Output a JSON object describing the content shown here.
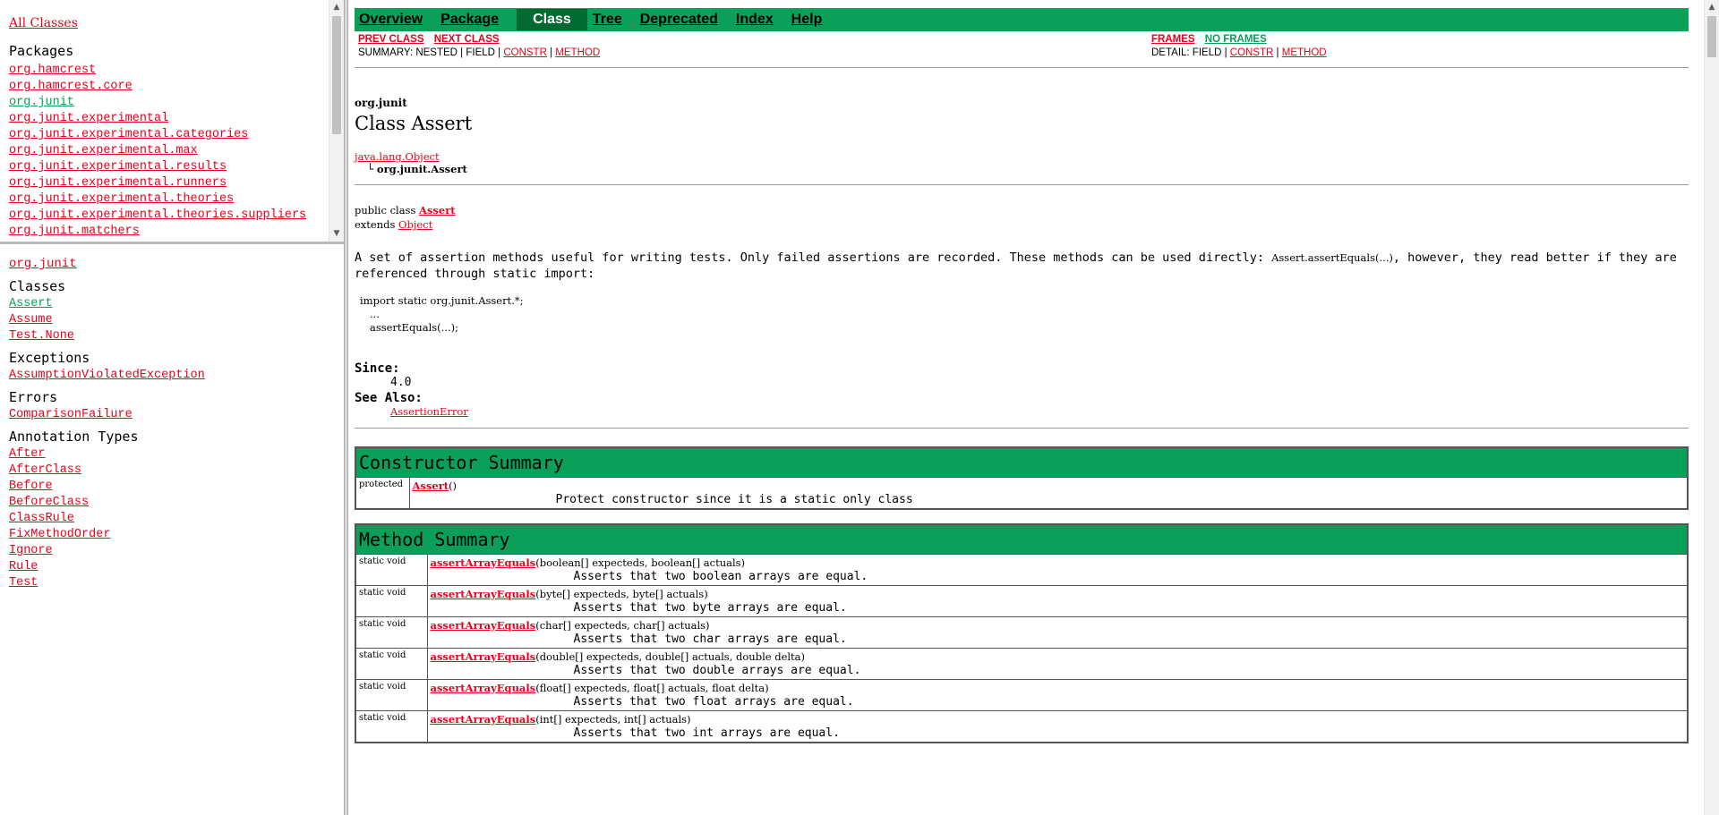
{
  "packages_frame": {
    "all_classes": "All Classes",
    "heading": "Packages",
    "items": [
      {
        "label": "org.hamcrest",
        "visited": false
      },
      {
        "label": "org.hamcrest.core",
        "visited": false
      },
      {
        "label": "org.junit",
        "visited": true
      },
      {
        "label": "org.junit.experimental",
        "visited": false
      },
      {
        "label": "org.junit.experimental.categories",
        "visited": false
      },
      {
        "label": "org.junit.experimental.max",
        "visited": false
      },
      {
        "label": "org.junit.experimental.results",
        "visited": false
      },
      {
        "label": "org.junit.experimental.runners",
        "visited": false
      },
      {
        "label": "org.junit.experimental.theories",
        "visited": false
      },
      {
        "label": "org.junit.experimental.theories.suppliers",
        "visited": false
      },
      {
        "label": "org.junit.matchers",
        "visited": false
      }
    ]
  },
  "classes_frame": {
    "package": "org.junit",
    "groups": [
      {
        "heading": "Classes",
        "items": [
          "Assert",
          "Assume",
          "Test.None"
        ]
      },
      {
        "heading": "Exceptions",
        "items": [
          "AssumptionViolatedException"
        ]
      },
      {
        "heading": "Errors",
        "items": [
          "ComparisonFailure"
        ]
      },
      {
        "heading": "Annotation Types",
        "items": [
          "After",
          "AfterClass",
          "Before",
          "BeforeClass",
          "ClassRule",
          "FixMethodOrder",
          "Ignore",
          "Rule",
          "Test"
        ]
      }
    ],
    "visited_item": "Assert"
  },
  "navbar": {
    "overview": "Overview",
    "package": "Package",
    "class": "Class",
    "tree": "Tree",
    "deprecated": "Deprecated",
    "index": "Index",
    "help": "Help"
  },
  "subnav": {
    "prev_class": "PREV CLASS",
    "next_class": "NEXT CLASS",
    "frames": "FRAMES",
    "no_frames": "NO FRAMES",
    "summary_prefix": "SUMMARY: NESTED | FIELD |",
    "detail_prefix": "DETAIL: FIELD |",
    "constr": "CONSTR",
    "sep": "|",
    "method": "METHOD"
  },
  "class_header": {
    "package": "org.junit",
    "title": "Class Assert",
    "parent": "java.lang.Object",
    "child": "└ org.junit.Assert",
    "decl_public": "public class",
    "decl_name": "Assert",
    "decl_extends": "extends",
    "decl_super": "Object"
  },
  "description": {
    "text_before": "A set of assertion methods useful for writing tests. Only failed assertions are recorded. These methods can be used directly: ",
    "code": "Assert.assertEquals(...)",
    "text_after": ", however, they read better if they are referenced through static import:",
    "code_block": "import static org.junit.Assert.*;\n   ...\n   assertEquals(...);"
  },
  "since": {
    "since_label": "Since:",
    "since_value": "4.0",
    "see_label": "See Also:",
    "see_value": "AssertionError"
  },
  "constructor_summary": {
    "heading": "Constructor Summary",
    "rows": [
      {
        "modifier": "protected",
        "name": "Assert",
        "params": "()",
        "desc": "Protect constructor since it is a static only class"
      }
    ]
  },
  "method_summary": {
    "heading": "Method Summary",
    "rows": [
      {
        "modifier": "static  void",
        "name": "assertArrayEquals",
        "params": "(boolean[]  expecteds, boolean[]  actuals)",
        "desc": "Asserts that two boolean arrays are equal."
      },
      {
        "modifier": "static  void",
        "name": "assertArrayEquals",
        "params": "(byte[]  expecteds, byte[]  actuals)",
        "desc": "Asserts that two byte arrays are equal."
      },
      {
        "modifier": "static  void",
        "name": "assertArrayEquals",
        "params": "(char[]  expecteds, char[]  actuals)",
        "desc": "Asserts that two char arrays are equal."
      },
      {
        "modifier": "static  void",
        "name": "assertArrayEquals",
        "params": "(double[]  expecteds, double[]  actuals, double  delta)",
        "desc": "Asserts that two double arrays are equal."
      },
      {
        "modifier": "static  void",
        "name": "assertArrayEquals",
        "params": "(float[]  expecteds, float[]  actuals, float  delta)",
        "desc": "Asserts that two float arrays are equal."
      },
      {
        "modifier": "static  void",
        "name": "assertArrayEquals",
        "params": "(int[]  expecteds, int[]  actuals)",
        "desc": "Asserts that two int arrays are equal."
      }
    ]
  },
  "colors": {
    "accent_green": "#0aa05a",
    "link_red": "#e8001c",
    "visited_green": "#0a9e57"
  }
}
